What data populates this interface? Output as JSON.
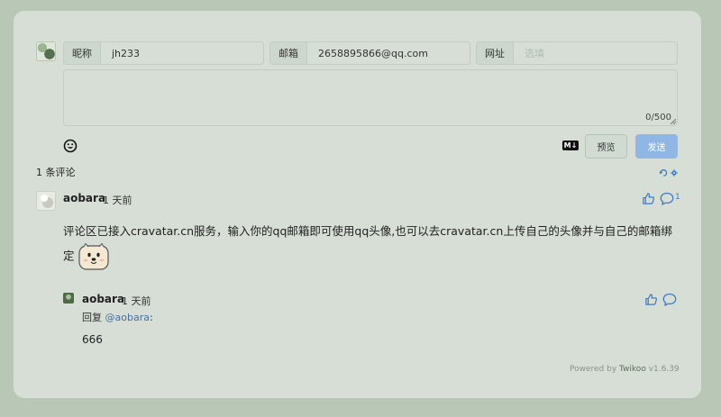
{
  "form": {
    "nick_label": "昵称",
    "nick_value": "jh233",
    "mail_label": "邮箱",
    "mail_value": "2658895866@qq.com",
    "link_label": "网址",
    "link_placeholder": "选填",
    "comment_value": "",
    "counter": "0/500",
    "md_label": "M↓",
    "preview_label": "预览",
    "send_label": "发送"
  },
  "comments_count_label": "1 条评论",
  "comment": {
    "nick": "aobara",
    "time": "1 天前",
    "content": "评论区已接入cravatar.cn服务，输入你的qq邮箱即可使用qq头像,也可以去cravatar.cn上传自己的头像并与自己的邮箱绑定",
    "like_count": "1"
  },
  "reply": {
    "nick": "aobara",
    "time": "1 天前",
    "reply_prefix": "回复",
    "reply_target": "@aobara",
    "reply_suffix": ":",
    "content": "666"
  },
  "footer": {
    "powered_prefix": "Powered by",
    "brand": "Twikoo",
    "version": "v1.6.39"
  },
  "colors": {
    "page_bg": "#b8c7b6",
    "card_bg": "#d6ded5",
    "accent": "#3e7bc6",
    "send_button": "#8fb6e4"
  }
}
